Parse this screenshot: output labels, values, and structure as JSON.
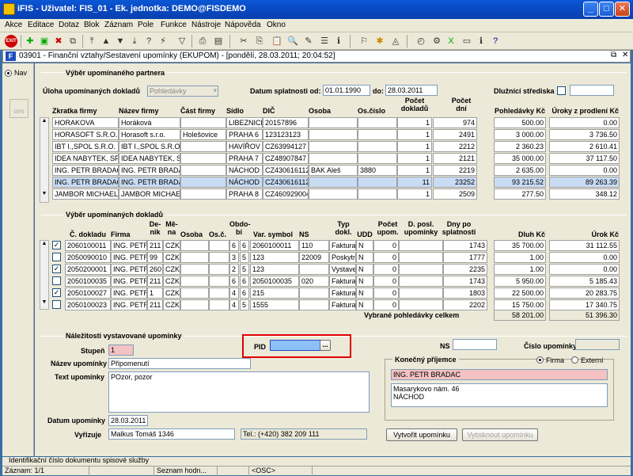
{
  "window": {
    "title": "iFIS - Uživatel: FIS_01 - Ek. jednotka: DEMO@FISDEMO"
  },
  "menu": [
    "Akce",
    "Editace",
    "Dotaz",
    "Blok",
    "Záznam",
    "Pole",
    "Funkce",
    "Nástroje",
    "Nápověda",
    "Okno"
  ],
  "form": {
    "title": "03901 - Finanční vztahy/Sestavení upomínky (EKUPOM) - [pondělí, 28.03.2011; 20:04:52]"
  },
  "left": {
    "nav_label": "Nav",
    "gps_label": "GPS"
  },
  "partner": {
    "section": "Výběr upomínaného partnera",
    "task_label": "Úloha upomínaných dokladů",
    "task_value": "Pohledávky",
    "due_label": "Datum splatnosti od:",
    "due_from": "01.01.1990",
    "due_to_label": "do:",
    "due_to": "28.03.2011",
    "centres_label": "Dlužnící střediska",
    "columns": [
      "Zkratka firmy",
      "Název firmy",
      "Část firmy",
      "Sídlo",
      "DIČ",
      "Osoba",
      "Os.číslo",
      "Počet dokladů",
      "Počet dní",
      "Pohledávky Kč",
      "Úroky z prodlení Kč"
    ],
    "rows": [
      [
        "HORAKOVA",
        "Horáková",
        "",
        "LIBEZNICE U",
        "20157896",
        "",
        "",
        "1",
        "974",
        "500.00",
        "0.00"
      ],
      [
        "HORASOFT S.R.O. Ho",
        "Horasoft s.r.o.",
        "Holešovice",
        "PRAHA 6",
        "123123123",
        "",
        "",
        "1",
        "2491",
        "3 000.00",
        "3 736.50"
      ],
      [
        "IBT I.,SPOL S.R.O.",
        "IBT I.,SPOL S.R.O.",
        "",
        "HAVÍŘOV -",
        "CZ63994127",
        "",
        "",
        "1",
        "2212",
        "2 360.23",
        "2 610.41"
      ],
      [
        "IDEA NABYTEK, SPOL",
        "IDEA NABYTEK, SP",
        "",
        "PRAHA 7",
        "CZ48907847",
        "",
        "",
        "1",
        "2121",
        "35 000.00",
        "37 117.50"
      ],
      [
        "ING. PETR BRADAC",
        "ING. PETR BRADAC",
        "",
        "NÁCHOD",
        "CZ430616112",
        "BAK Aleš",
        "3880",
        "1",
        "2219",
        "2 635.00",
        "0.00"
      ],
      [
        "ING. PETR BRADAC",
        "ING. PETR BRADAC",
        "",
        "NÁCHOD",
        "CZ430616112",
        "",
        "",
        "11",
        "23252",
        "93 215.52",
        "89 263.39"
      ],
      [
        "JAMBOR MICHAEL",
        "JAMBOR MICHAEL",
        "",
        "PRAHA 8",
        "CZ460929004",
        "",
        "",
        "1",
        "2509",
        "277.50",
        "348.12"
      ]
    ]
  },
  "docs": {
    "section": "Výběr upomínaných dokladů",
    "columns": [
      "Č. dokladu",
      "Firma",
      "De-nik",
      "Mě-na",
      "Osoba",
      "Os.č.",
      "Obdo-bí",
      "",
      "Var. symbol",
      "NS",
      "Typ dokl.",
      "UDD",
      "Počet upom.",
      "D. posl. upomínky",
      "Dny po splatnosti",
      "Dluh Kč",
      "Úrok Kč"
    ],
    "rows": [
      {
        "checked": true,
        "cells": [
          "2060100011",
          "ING. PETR B",
          "211",
          "CZK",
          "",
          "",
          "6",
          "6",
          "2060100011",
          "110",
          "Faktura",
          "N",
          "0",
          "",
          "1743",
          "35 700.00",
          "31 112.55"
        ]
      },
      {
        "checked": false,
        "cells": [
          "2050090010",
          "ING. PETR B",
          "99",
          "CZK",
          "",
          "",
          "3",
          "5",
          "123",
          "22009",
          "Poskytn",
          "N",
          "0",
          "",
          "1777",
          "1.00",
          "0.00"
        ]
      },
      {
        "checked": true,
        "cells": [
          "2050200001",
          "ING. PETR B",
          "260",
          "CZK",
          "",
          "",
          "2",
          "5",
          "123",
          "",
          "Vystave",
          "N",
          "0",
          "",
          "2235",
          "1.00",
          "0.00"
        ]
      },
      {
        "checked": false,
        "cells": [
          "2050100035",
          "ING. PETR B",
          "211",
          "CZK",
          "",
          "",
          "6",
          "6",
          "2050100035",
          "020",
          "Faktura",
          "N",
          "0",
          "",
          "1743",
          "5 950.00",
          "5 185.43"
        ]
      },
      {
        "checked": true,
        "cells": [
          "2050100027",
          "ING. PETR B",
          "1",
          "CZK",
          "",
          "",
          "4",
          "6",
          "215",
          "",
          "Faktura",
          "N",
          "0",
          "",
          "1803",
          "22 500.00",
          "20 283.75"
        ]
      },
      {
        "checked": false,
        "cells": [
          "2050100023",
          "ING. PETR B",
          "211",
          "CZK",
          "",
          "",
          "4",
          "5",
          "1555",
          "",
          "Faktura",
          "N",
          "0",
          "",
          "2202",
          "15 750.00",
          "17 340.75"
        ]
      }
    ],
    "total_label": "Vybrané pohledávky celkem",
    "total_debt": "58 201.00",
    "total_interest": "51 396.30"
  },
  "reminder": {
    "section": "Náležitosti vystavované upomínky",
    "level_label": "Stupeň",
    "level": "1",
    "pid_label": "PID",
    "pid_btn": "...",
    "ns_label": "NS",
    "number_label": "Číslo upomínky",
    "name_label": "Název upomínky",
    "name": "Připomenutí",
    "text_label": "Text upomínky",
    "text": "POzor, pozor",
    "date_label": "Datum upomínky",
    "date": "28.03.2011",
    "handler_label": "Vyřizuje",
    "handler": "Malkus Tomáš 1346",
    "phone": "Tel.: (+420) 382 209 111",
    "recipient_label": "Konečný příjemce",
    "opt_firm": "Firma",
    "opt_ext": "Externí",
    "recipient_name": "ING. PETR BRADAC",
    "recipient_addr1": "Masarykovo nám. 46",
    "recipient_addr2": "NÁCHOD",
    "create_btn": "Vytvořit upomínku",
    "print_btn": "Vytisknout upomínku"
  },
  "status": {
    "hint": "Identifikační číslo dokumentu spisové služby",
    "record": "Záznam: 1/1",
    "list": "Seznam hodn...",
    "osc": "<OSC>"
  }
}
